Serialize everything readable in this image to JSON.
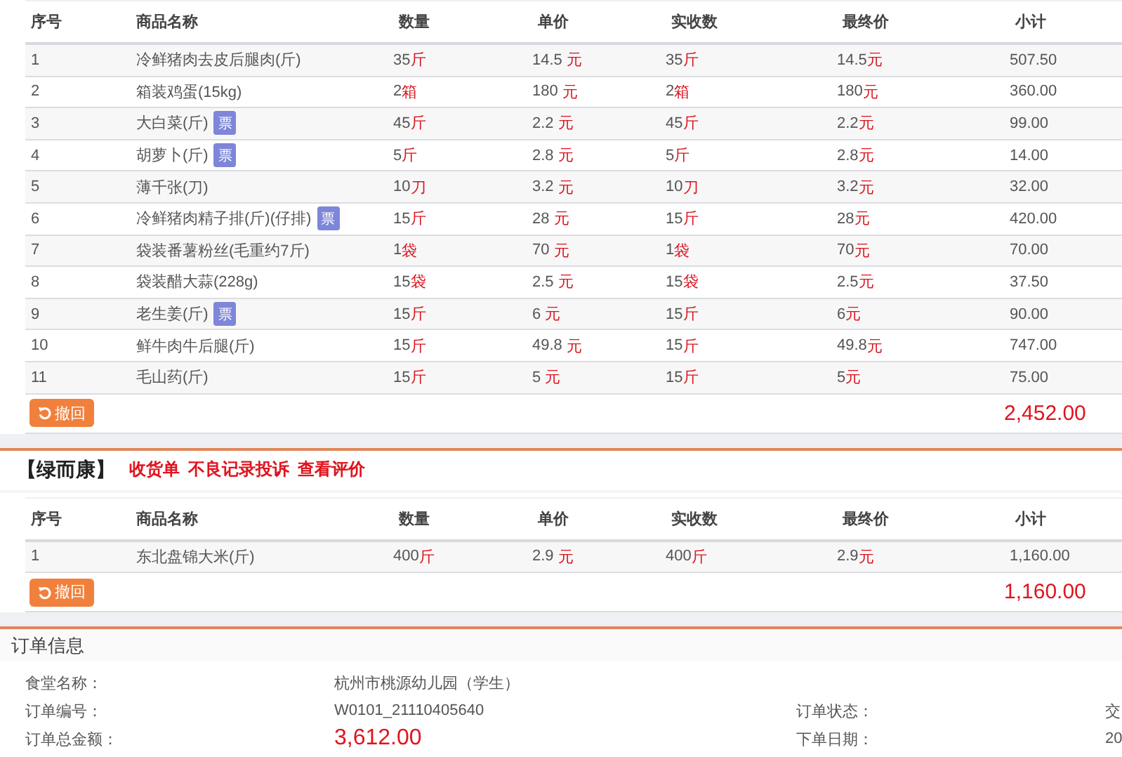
{
  "sections": [
    {
      "columns": [
        "序号",
        "商品名称",
        "数量",
        "单价",
        "实收数",
        "最终价",
        "小计"
      ],
      "rows": [
        {
          "no": "1",
          "name": "冷鲜猪肉去皮后腿肉(斤)",
          "qty": {
            "value": "35",
            "unit": "斤"
          },
          "price": {
            "value": "14.5",
            "unit": "元"
          },
          "received": {
            "value": "35",
            "unit": "斤"
          },
          "final": {
            "value": "14.5",
            "unit": "元"
          },
          "subtotal": "507.50"
        },
        {
          "no": "2",
          "name": "箱装鸡蛋(15kg)",
          "qty": {
            "value": "2",
            "unit": "箱"
          },
          "price": {
            "value": "180",
            "unit": "元"
          },
          "received": {
            "value": "2",
            "unit": "箱"
          },
          "final": {
            "value": "180",
            "unit": "元"
          },
          "subtotal": "360.00"
        },
        {
          "no": "3",
          "name": "大白菜(斤)",
          "badge": "票",
          "qty": {
            "value": "45",
            "unit": "斤"
          },
          "price": {
            "value": "2.2",
            "unit": "元"
          },
          "received": {
            "value": "45",
            "unit": "斤"
          },
          "final": {
            "value": "2.2",
            "unit": "元"
          },
          "subtotal": "99.00"
        },
        {
          "no": "4",
          "name": "胡萝卜(斤)",
          "badge": "票",
          "qty": {
            "value": "5",
            "unit": "斤"
          },
          "price": {
            "value": "2.8",
            "unit": "元"
          },
          "received": {
            "value": "5",
            "unit": "斤"
          },
          "final": {
            "value": "2.8",
            "unit": "元"
          },
          "subtotal": "14.00"
        },
        {
          "no": "5",
          "name": "薄千张(刀)",
          "qty": {
            "value": "10",
            "unit": "刀"
          },
          "price": {
            "value": "3.2",
            "unit": "元"
          },
          "received": {
            "value": "10",
            "unit": "刀"
          },
          "final": {
            "value": "3.2",
            "unit": "元"
          },
          "subtotal": "32.00"
        },
        {
          "no": "6",
          "name": "冷鲜猪肉精子排(斤)(仔排)",
          "badge": "票",
          "qty": {
            "value": "15",
            "unit": "斤"
          },
          "price": {
            "value": "28",
            "unit": "元"
          },
          "received": {
            "value": "15",
            "unit": "斤"
          },
          "final": {
            "value": "28",
            "unit": "元"
          },
          "subtotal": "420.00"
        },
        {
          "no": "7",
          "name": "袋装番薯粉丝(毛重约7斤)",
          "qty": {
            "value": "1",
            "unit": "袋"
          },
          "price": {
            "value": "70",
            "unit": "元"
          },
          "received": {
            "value": "1",
            "unit": "袋"
          },
          "final": {
            "value": "70",
            "unit": "元"
          },
          "subtotal": "70.00"
        },
        {
          "no": "8",
          "name": "袋装醋大蒜(228g)",
          "qty": {
            "value": "15",
            "unit": "袋"
          },
          "price": {
            "value": "2.5",
            "unit": "元"
          },
          "received": {
            "value": "15",
            "unit": "袋"
          },
          "final": {
            "value": "2.5",
            "unit": "元"
          },
          "subtotal": "37.50"
        },
        {
          "no": "9",
          "name": "老生姜(斤)",
          "badge": "票",
          "qty": {
            "value": "15",
            "unit": "斤"
          },
          "price": {
            "value": "6",
            "unit": "元"
          },
          "received": {
            "value": "15",
            "unit": "斤"
          },
          "final": {
            "value": "6",
            "unit": "元"
          },
          "subtotal": "90.00"
        },
        {
          "no": "10",
          "name": "鲜牛肉牛后腿(斤)",
          "qty": {
            "value": "15",
            "unit": "斤"
          },
          "price": {
            "value": "49.8",
            "unit": "元"
          },
          "received": {
            "value": "15",
            "unit": "斤"
          },
          "final": {
            "value": "49.8",
            "unit": "元"
          },
          "subtotal": "747.00"
        },
        {
          "no": "11",
          "name": "毛山药(斤)",
          "qty": {
            "value": "15",
            "unit": "斤"
          },
          "price": {
            "value": "5",
            "unit": "元"
          },
          "received": {
            "value": "15",
            "unit": "斤"
          },
          "final": {
            "value": "5",
            "unit": "元"
          },
          "subtotal": "75.00"
        }
      ],
      "withdraw_button": "撤回",
      "total": "2,452.00"
    },
    {
      "store": {
        "name": "【绿而康】",
        "links": [
          "收货单",
          "不良记录投诉",
          "查看评价"
        ]
      },
      "columns": [
        "序号",
        "商品名称",
        "数量",
        "单价",
        "实收数",
        "最终价",
        "小计"
      ],
      "rows": [
        {
          "no": "1",
          "name": "东北盘锦大米(斤)",
          "qty": {
            "value": "400",
            "unit": "斤"
          },
          "price": {
            "value": "2.9",
            "unit": "元"
          },
          "received": {
            "value": "400",
            "unit": "斤"
          },
          "final": {
            "value": "2.9",
            "unit": "元"
          },
          "subtotal": "1,160.00"
        }
      ],
      "withdraw_button": "撤回",
      "total": "1,160.00"
    }
  ],
  "order_info": {
    "title": "订单信息",
    "fields": [
      {
        "label": "食堂名称：",
        "value": "杭州市桃源幼儿园（学生）"
      },
      {
        "label": "订单编号：",
        "value": "W0101_21110405640"
      },
      {
        "label": "订单状态：",
        "value": "交"
      },
      {
        "label": "订单总金额：",
        "value": "3,612.00",
        "kind": "amount"
      },
      {
        "label": "下单日期：",
        "value": "20"
      }
    ]
  }
}
